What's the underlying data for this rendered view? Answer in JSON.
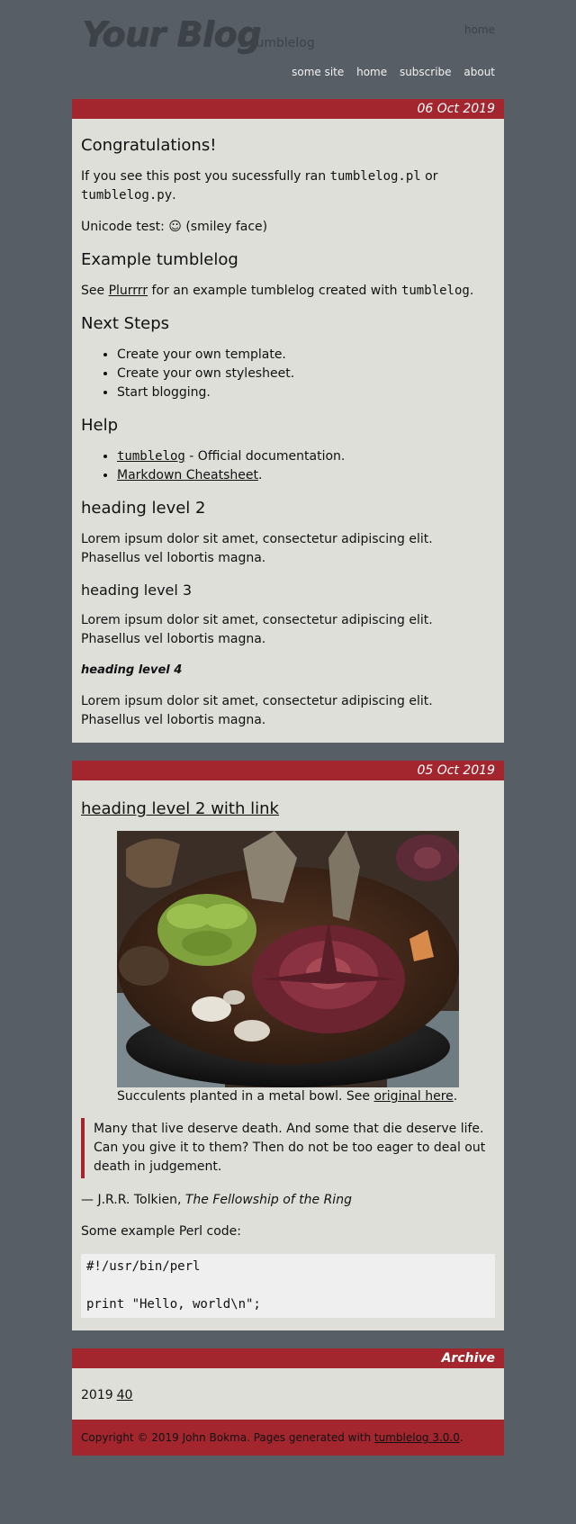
{
  "header": {
    "title": "Your Blog",
    "tagline": "a tumblelog",
    "top_nav": "home",
    "nav": [
      "some site",
      "home",
      "subscribe",
      "about"
    ]
  },
  "post1": {
    "date": "06 Oct 2019",
    "h_congrats": "Congratulations!",
    "p1_a": "If you see this post you sucessfully ran ",
    "p1_code1": "tumblelog.pl",
    "p1_b": " or ",
    "p1_code2": "tumblelog.py",
    "p1_c": ".",
    "unicode": "Unicode test: ☺ (smiley face)",
    "h_example": "Example tumblelog",
    "p2_a": "See ",
    "p2_link": "Plurrrr",
    "p2_b": " for an example tumblelog created with ",
    "p2_code": "tumblelog",
    "p2_c": ".",
    "h_next": "Next Steps",
    "next_steps": [
      "Create your own template.",
      "Create your own stylesheet.",
      "Start blogging."
    ],
    "h_help": "Help",
    "help1_link": "tumblelog",
    "help1_text": " - Official documentation.",
    "help2_link": "Markdown Cheatsheet",
    "help2_text": ".",
    "h2": "heading level 2",
    "h3": "heading level 3",
    "h4": "heading level 4",
    "lorem": "Lorem ipsum dolor sit amet, consectetur adipiscing elit. Phasellus vel lobortis magna."
  },
  "post2": {
    "date": "05 Oct 2019",
    "heading_link": "heading level 2 with link",
    "caption_a": "Succulents planted in a metal bowl. See ",
    "caption_link": "original here",
    "caption_b": ".",
    "quote": "Many that live deserve death. And some that die deserve life. Can you give it to them? Then do not be too eager to deal out death in judgement.",
    "attribution_a": "— J.R.R. Tolkien, ",
    "attribution_book": "The Fellowship of the Ring",
    "perl_intro": "Some example Perl code:",
    "code": "#!/usr/bin/perl\n\nprint \"Hello, world\\n\";"
  },
  "archive": {
    "title": "Archive",
    "year": "2019",
    "week": "40"
  },
  "footer": {
    "text": "Copyright © 2019 John Bokma. Pages generated with ",
    "link": "tumblelog 3.0.0",
    "end": "."
  },
  "colors": {
    "background": "#575e66",
    "accent": "#a3262f",
    "article_bg": "#dfdfda"
  }
}
